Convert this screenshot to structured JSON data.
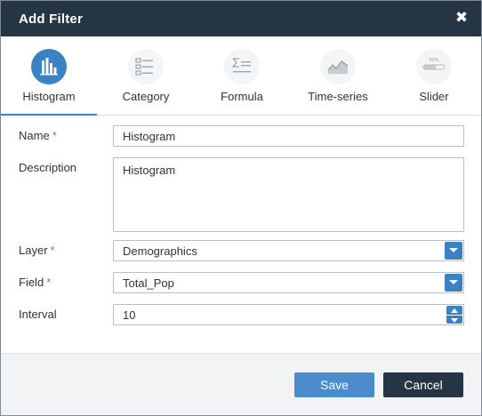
{
  "dialog": {
    "title": "Add Filter",
    "close_icon": "close-icon"
  },
  "tabs": [
    {
      "label": "Histogram",
      "icon": "histogram-icon",
      "active": true
    },
    {
      "label": "Category",
      "icon": "category-list-icon",
      "active": false
    },
    {
      "label": "Formula",
      "icon": "formula-icon",
      "active": false
    },
    {
      "label": "Time-series",
      "icon": "time-series-icon",
      "active": false
    },
    {
      "label": "Slider",
      "icon": "slider-icon",
      "active": false,
      "icon_text": "60%"
    }
  ],
  "form": {
    "name": {
      "label": "Name",
      "required_mark": "*",
      "value": "Histogram"
    },
    "description": {
      "label": "Description",
      "value": "Histogram"
    },
    "layer": {
      "label": "Layer",
      "required_mark": "*",
      "value": "Demographics"
    },
    "field": {
      "label": "Field",
      "required_mark": "*",
      "value": "Total_Pop"
    },
    "interval": {
      "label": "Interval",
      "value": "10"
    }
  },
  "footer": {
    "save_label": "Save",
    "cancel_label": "Cancel"
  },
  "colors": {
    "titlebar": "#263543",
    "accent": "#3b82c4",
    "required": "#d9534f",
    "cancel": "#263543"
  }
}
